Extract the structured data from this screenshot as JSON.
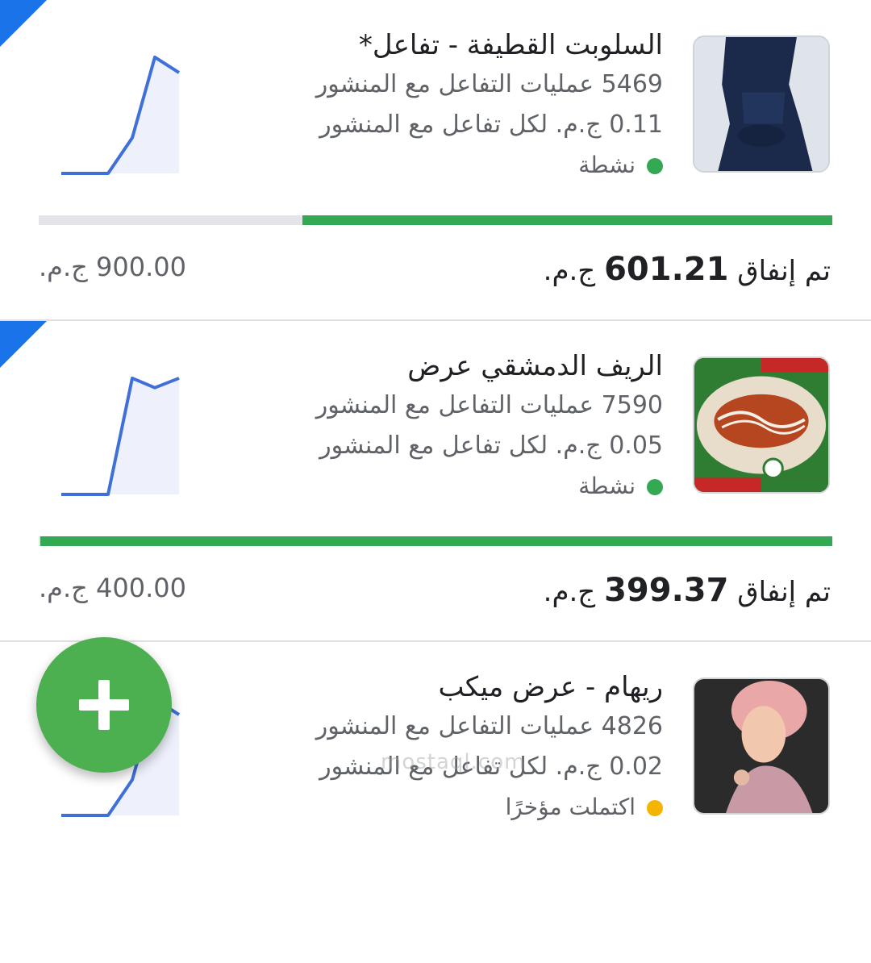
{
  "colors": {
    "accent": "#1a73e8",
    "active": "#34a853",
    "pending": "#f4b400",
    "fab": "#4caf50"
  },
  "campaigns": [
    {
      "title": "السلوبت القطيفة - تفاعل*",
      "engagements": "5469 عمليات  التفاعل مع المنشور",
      "cost": "0.11 ج.م. لكل تفاعل مع المنشور",
      "status": "نشطة",
      "status_color": "#34a853",
      "spent_prefix": "تم إنفاق",
      "spent_value": "601.21",
      "spent_suffix": "ج.م.",
      "budget": "900.00 ج.م.",
      "progress": 0.668,
      "trend": [
        0,
        0,
        0.3,
        0.98,
        0.85
      ]
    },
    {
      "title": "الريف الدمشقي عرض",
      "engagements": "7590 عمليات  التفاعل مع المنشور",
      "cost": "0.05 ج.م. لكل تفاعل مع المنشور",
      "status": "نشطة",
      "status_color": "#34a853",
      "spent_prefix": "تم إنفاق",
      "spent_value": "399.37",
      "spent_suffix": "ج.م.",
      "budget": "400.00 ج.م.",
      "progress": 0.998,
      "trend": [
        0,
        0,
        0.98,
        0.9,
        0.98
      ]
    },
    {
      "title": "ريهام - عرض ميكب",
      "engagements": "4826 عمليات  التفاعل مع المنشور",
      "cost": "0.02 ج.م. لكل تفاعل مع المنشور",
      "status": "اكتملت مؤخرًا",
      "status_color": "#f4b400",
      "trend": [
        0,
        0,
        0.3,
        0.98,
        0.85
      ]
    }
  ],
  "fab": {
    "icon": "plus-icon"
  },
  "watermark": "mostaql.com"
}
